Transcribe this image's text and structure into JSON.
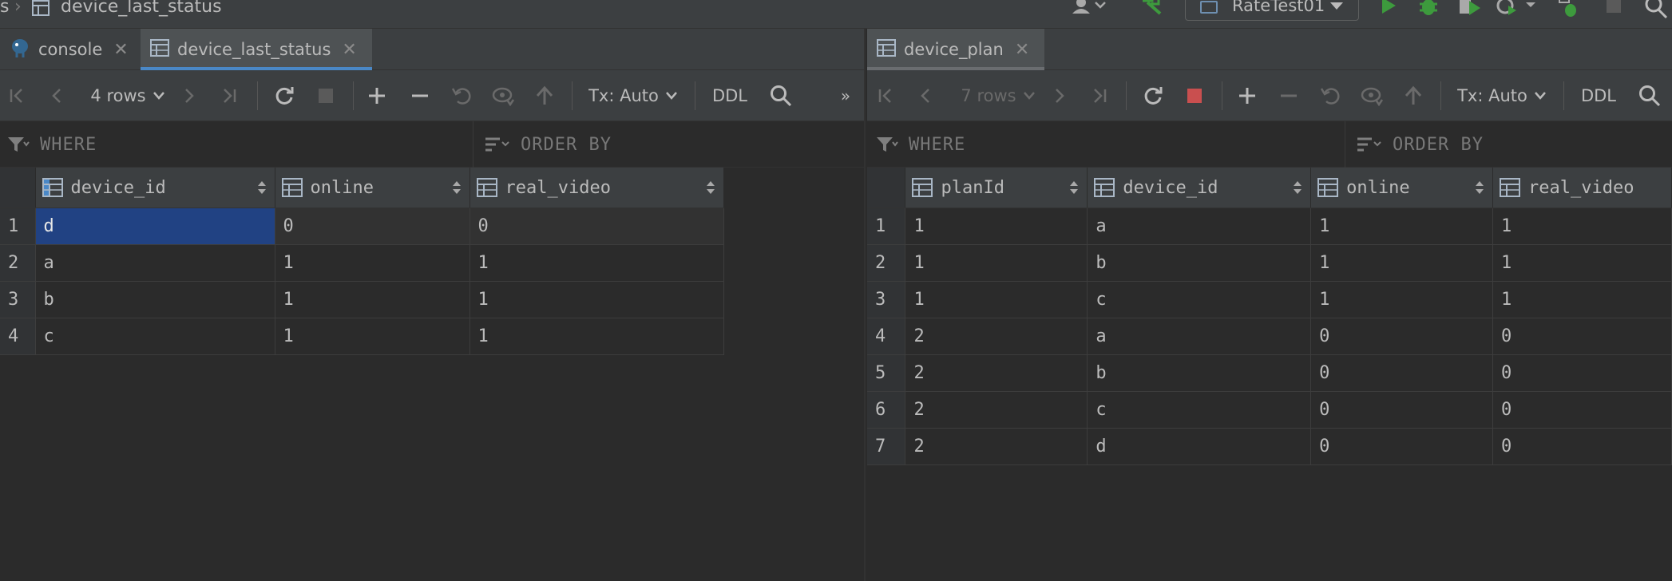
{
  "navbar": {
    "crumb_prefix": "s",
    "crumb_table": "device_last_status",
    "run_config": "RateTest01"
  },
  "left": {
    "tabs": [
      {
        "label": "console",
        "active": false
      },
      {
        "label": "device_last_status",
        "active": true
      }
    ],
    "toolbar": {
      "rows": "4 rows",
      "tx": "Tx: Auto",
      "ddl": "DDL"
    },
    "filter": {
      "where": "WHERE",
      "order": "ORDER BY"
    },
    "columns": [
      "device_id",
      "online",
      "real_video"
    ],
    "rows": [
      [
        "1",
        "d",
        "0",
        "0"
      ],
      [
        "2",
        "a",
        "1",
        "1"
      ],
      [
        "3",
        "b",
        "1",
        "1"
      ],
      [
        "4",
        "c",
        "1",
        "1"
      ]
    ]
  },
  "right": {
    "tabs": [
      {
        "label": "device_plan",
        "active": true
      }
    ],
    "toolbar": {
      "rows": "7 rows",
      "tx": "Tx: Auto",
      "ddl": "DDL"
    },
    "filter": {
      "where": "WHERE",
      "order": "ORDER BY"
    },
    "columns": [
      "planId",
      "device_id",
      "online",
      "real_video"
    ],
    "rows": [
      [
        "1",
        "1",
        "a",
        "1",
        "1"
      ],
      [
        "2",
        "1",
        "b",
        "1",
        "1"
      ],
      [
        "3",
        "1",
        "c",
        "1",
        "1"
      ],
      [
        "4",
        "2",
        "a",
        "0",
        "0"
      ],
      [
        "5",
        "2",
        "b",
        "0",
        "0"
      ],
      [
        "6",
        "2",
        "c",
        "0",
        "0"
      ],
      [
        "7",
        "2",
        "d",
        "0",
        "0"
      ]
    ]
  },
  "colors": {
    "accent": "#4a88c7",
    "selection": "#214283",
    "run": "#3d9a3d",
    "stop": "#c94f4f"
  }
}
